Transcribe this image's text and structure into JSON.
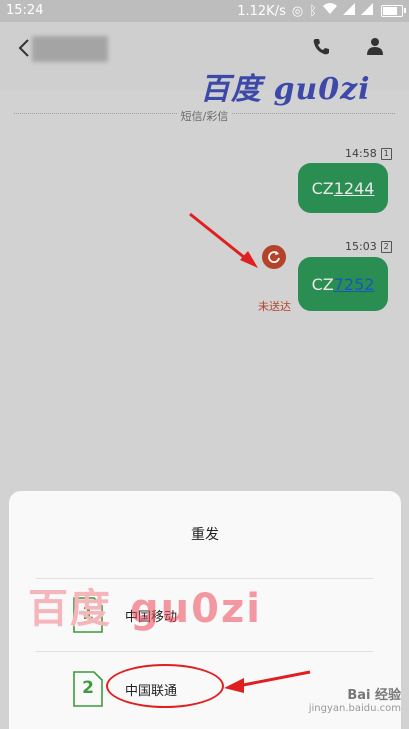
{
  "status_bar": {
    "time": "15:24",
    "speed": "1.12K/s"
  },
  "watermarks": {
    "top": "百度 gu0zi",
    "mid_cn": "百度",
    "mid_latin": "gu0zi",
    "bottom": "Bai 经验",
    "url": "jingyan.baidu.com"
  },
  "divider_label": "短信/彩信",
  "messages": [
    {
      "time": "14:58",
      "sim": "1",
      "prefix": "CZ",
      "link": "1244"
    },
    {
      "time": "15:03",
      "sim": "2",
      "prefix": "CZ",
      "link": "7252",
      "status": "未送达"
    }
  ],
  "dialog": {
    "title": "重发",
    "options": [
      {
        "sim": "1",
        "label": "中国移动"
      },
      {
        "sim": "2",
        "label": "中国联通"
      }
    ]
  },
  "colors": {
    "bubble": "#2a8d52",
    "error": "#b4432a",
    "annotation": "#e02020",
    "sim": "#3c9a3c"
  }
}
